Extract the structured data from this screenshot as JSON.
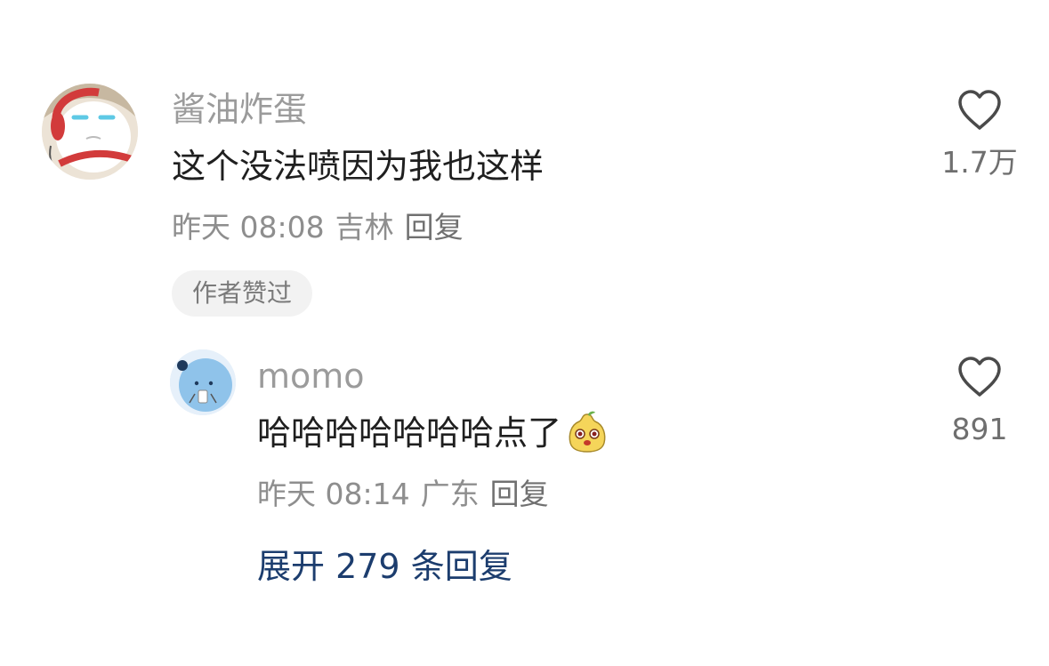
{
  "comments": [
    {
      "username": "酱油炸蛋",
      "content": "这个没法喷因为我也这样",
      "time": "昨天 08:08",
      "location": "吉林",
      "reply_label": "回复",
      "badge": "作者赞过",
      "like_count": "1.7万",
      "avatar_icon": "cartoon-face-with-headphones"
    },
    {
      "username": "momo",
      "content": "哈哈哈哈哈哈哈点了",
      "emoji_icon": "yellow-pear-face-emoji",
      "time": "昨天 08:14",
      "location": "广东",
      "reply_label": "回复",
      "like_count": "891",
      "avatar_icon": "blue-blob-character"
    }
  ],
  "expand_replies": "展开 279 条回复",
  "icons": {
    "like": "heart-outline-icon"
  },
  "colors": {
    "username": "#9b9b9b",
    "link": "#1c3d6e",
    "badge_bg": "#f2f2f2"
  }
}
